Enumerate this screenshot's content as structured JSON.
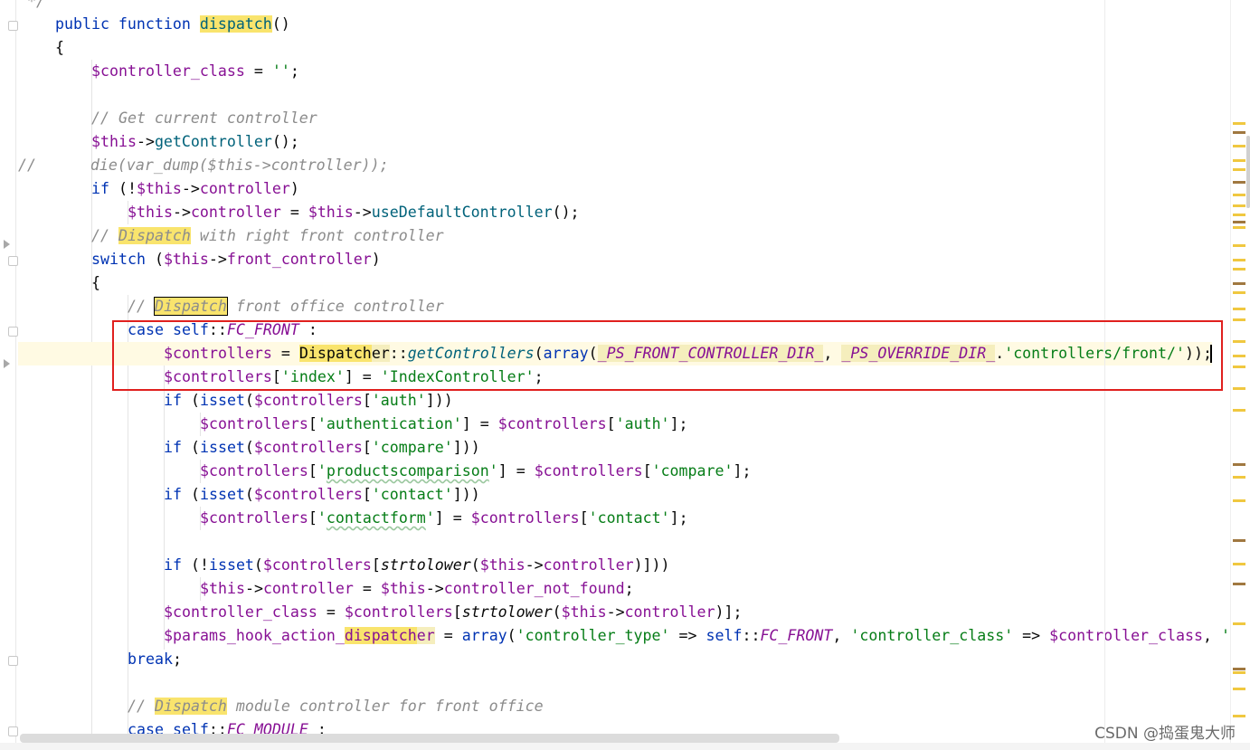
{
  "code_lines": [
    " */",
    "public function dispatch()",
    "{",
    "$controller_class = '';",
    "",
    "// Get current controller",
    "$this->getController();",
    "//      die(var_dump($this->controller));",
    "if (!$this->controller)",
    "$this->controller = $this->useDefaultController();",
    "// Dispatch with right front controller",
    "switch ($this->front_controller)",
    "{",
    "// Dispatch front office controller",
    "case self::FC_FRONT :",
    "$controllers = Dispatcher::getControllers(array(_PS_FRONT_CONTROLLER_DIR_, _PS_OVERRIDE_DIR_.'controllers/front/'));",
    "$controllers['index'] = 'IndexController';",
    "if (isset($controllers['auth']))",
    "$controllers['authentication'] = $controllers['auth'];",
    "if (isset($controllers['compare']))",
    "$controllers['productscomparison'] = $controllers['compare'];",
    "if (isset($controllers['contact']))",
    "$controllers['contactform'] = $controllers['contact'];",
    "",
    "if (!isset($controllers[strtolower($this->controller)]))",
    "$this->controller = $this->controller_not_found;",
    "$controller_class = $controllers[strtolower($this->controller)];",
    "$params_hook_action_dispatcher = array('controller_type' => self::FC_FRONT, 'controller_class' => $controller_class, 'is",
    "break;",
    "",
    "// Dispatch module controller for front office",
    "case self::FC_MODULE :"
  ],
  "colors": {
    "keyword": "#0033b3",
    "variable": "#871094",
    "function": "#00627a",
    "string": "#067d17",
    "comment": "#8c8c8c",
    "search_highlight": "#f9e46d",
    "red_box": "#e0201e"
  },
  "watermark": "CSDN @捣蛋鬼大师"
}
